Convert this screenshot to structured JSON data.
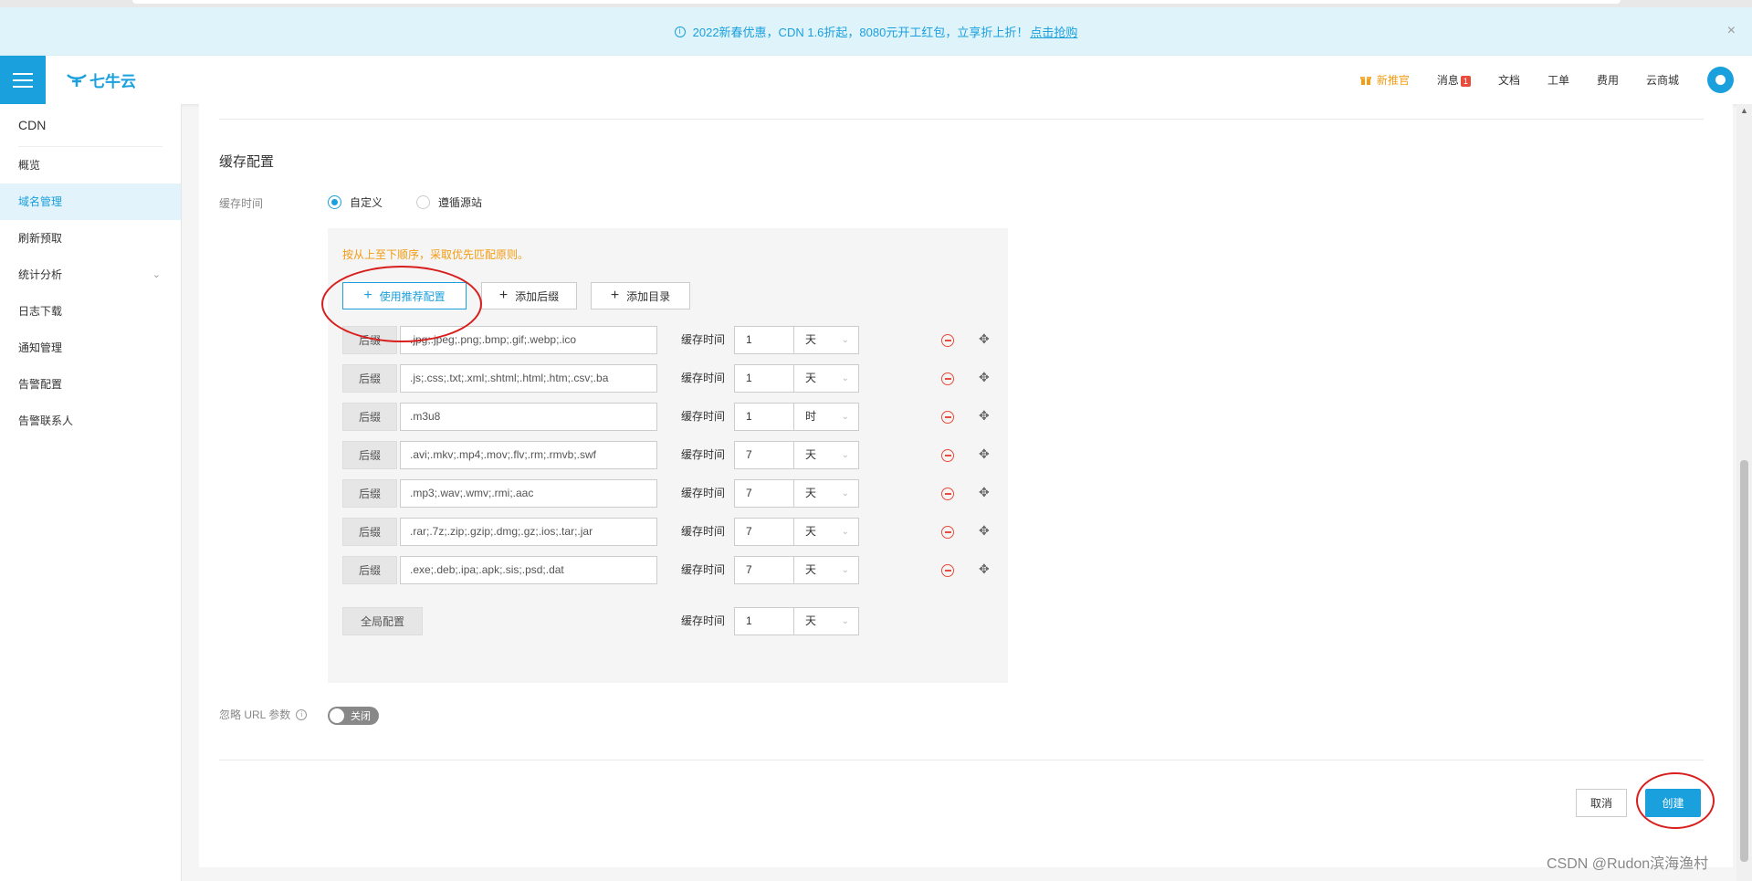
{
  "promo": {
    "text": "2022新春优惠，CDN 1.6折起，8080元开工红包，立享折上折！",
    "link": "点击抢购",
    "info_icon": "i",
    "close": "×"
  },
  "header": {
    "logo": "七牛云",
    "nav": {
      "new": "新推官",
      "messages": "消息",
      "messages_count": "1",
      "docs": "文档",
      "tickets": "工单",
      "billing": "费用",
      "mall": "云商城"
    }
  },
  "sidebar": {
    "title": "CDN",
    "items": [
      {
        "label": "概览"
      },
      {
        "label": "域名管理"
      },
      {
        "label": "刷新预取"
      },
      {
        "label": "统计分析"
      },
      {
        "label": "日志下载"
      },
      {
        "label": "通知管理"
      },
      {
        "label": "告警配置"
      },
      {
        "label": "告警联系人"
      }
    ]
  },
  "main": {
    "section_title": "缓存配置",
    "cache_time_label": "缓存时间",
    "radio_custom": "自定义",
    "radio_follow": "遵循源站",
    "hint": "按从上至下顺序，采取优先匹配原则。",
    "btn_recommend": "使用推荐配置",
    "btn_add_suffix": "添加后缀",
    "btn_add_dir": "添加目录",
    "row_tag": "后缀",
    "row_time_label": "缓存时间",
    "rows": [
      {
        "ext": ".jpg;.jpeg;.png;.bmp;.gif;.webp;.ico",
        "num": "1",
        "unit": "天"
      },
      {
        "ext": ".js;.css;.txt;.xml;.shtml;.html;.htm;.csv;.ba",
        "num": "1",
        "unit": "天"
      },
      {
        "ext": ".m3u8",
        "num": "1",
        "unit": "时"
      },
      {
        "ext": ".avi;.mkv;.mp4;.mov;.flv;.rm;.rmvb;.swf",
        "num": "7",
        "unit": "天"
      },
      {
        "ext": ".mp3;.wav;.wmv;.rmi;.aac",
        "num": "7",
        "unit": "天"
      },
      {
        "ext": ".rar;.7z;.zip;.gzip;.dmg;.gz;.ios;.tar;.jar",
        "num": "7",
        "unit": "天"
      },
      {
        "ext": ".exe;.deb;.ipa;.apk;.sis;.psd;.dat",
        "num": "7",
        "unit": "天"
      }
    ],
    "global_tag": "全局配置",
    "global_time_label": "缓存时间",
    "global_num": "1",
    "global_unit": "天",
    "ignore_url_label": "忽略 URL 参数",
    "toggle_label": "关闭",
    "cancel": "取消",
    "create": "创建"
  },
  "watermark": "CSDN @Rudon滨海渔村",
  "colors": {
    "accent": "#1aa0dc",
    "hint": "#f39c12",
    "danger": "#e74c3c",
    "annotation": "#d91e1e"
  }
}
